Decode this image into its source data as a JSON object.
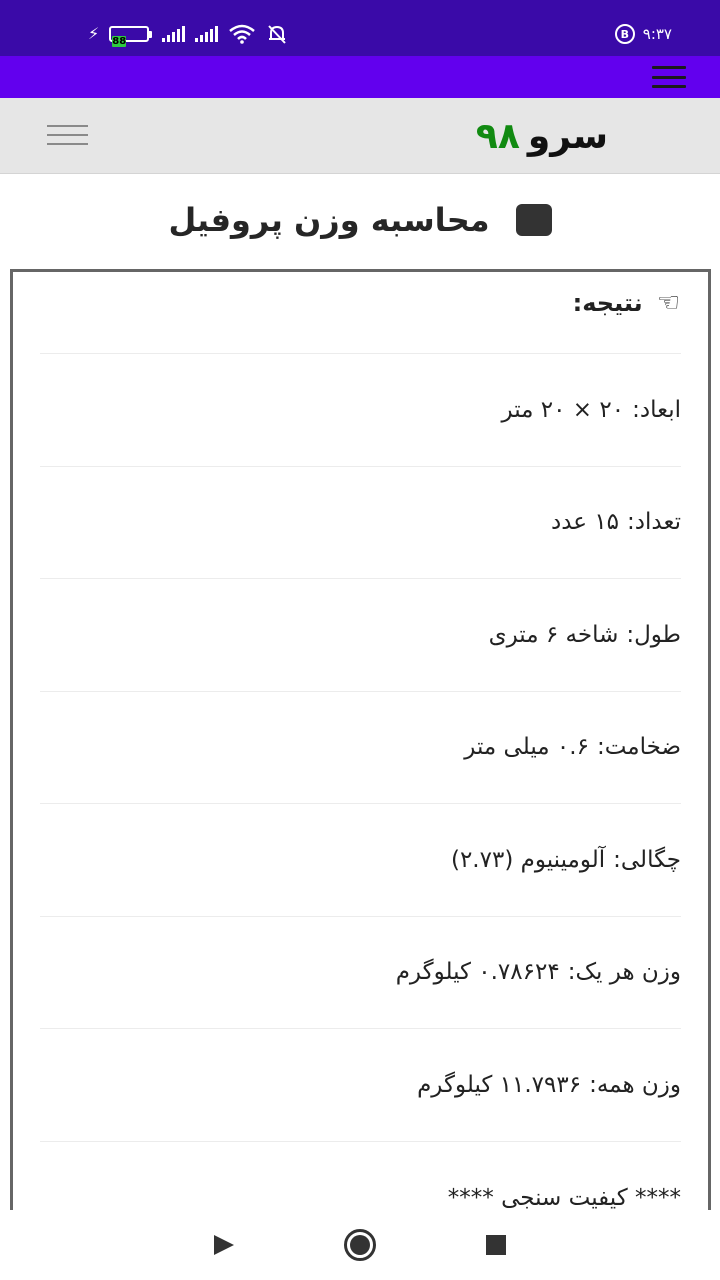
{
  "status_bar": {
    "time": "۹:۳۷",
    "battery": "88",
    "b_badge": "B",
    "charging_icon": "bolt-icon",
    "wifi_icon": "wifi-icon",
    "silent_icon": "bell-off-icon"
  },
  "header": {
    "logo_word": "سرو",
    "logo_number": "۹۸",
    "logo_number_color": "#118a11"
  },
  "page": {
    "title": "محاسبه وزن پروفیل"
  },
  "result": {
    "title": "نتیجه:",
    "hand_icon": "hand-pointer-icon",
    "rows": [
      {
        "label": "ابعاد:",
        "value": "۲۰ × ۲۰ متر"
      },
      {
        "label": "تعداد:",
        "value": "۱۵ عدد"
      },
      {
        "label": "طول:",
        "value": "شاخه ۶ متری"
      },
      {
        "label": "ضخامت:",
        "value": "۰.۶ میلی متر"
      },
      {
        "label": "چگالی:",
        "value": "آلومینیوم (۲.۷۳)"
      },
      {
        "label": "وزن هر یک:",
        "value": "۰.۷۸۶۲۴ کیلوگرم"
      },
      {
        "label": "وزن همه:",
        "value": "۱۱.۷۹۳۶ کیلوگرم"
      }
    ],
    "quality_text": "**** کیفیت سنجی ****"
  },
  "colors": {
    "status_bar": "#3a0aa8",
    "app_bar": "#6200ee",
    "header_bg": "#e6e6e6"
  }
}
